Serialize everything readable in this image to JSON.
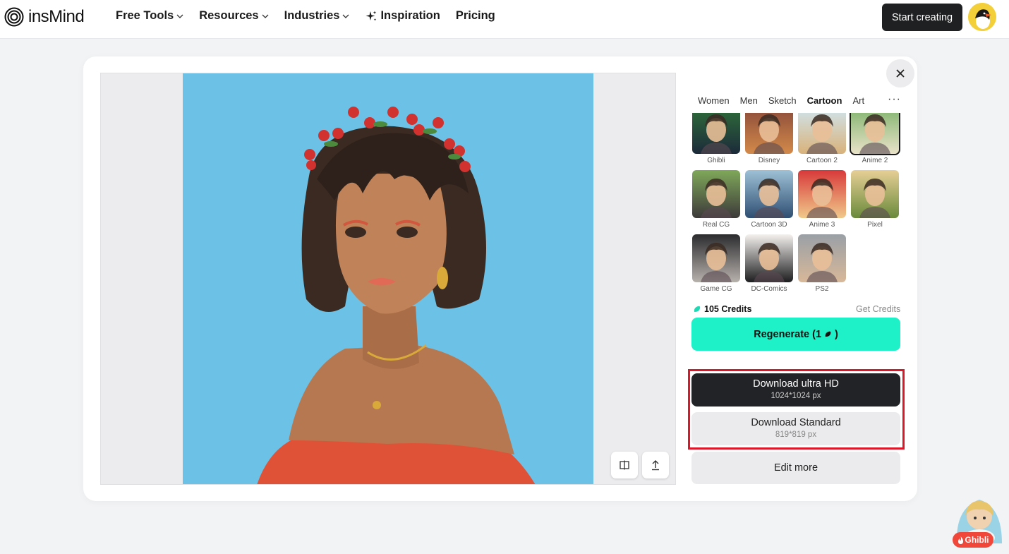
{
  "header": {
    "brand": "insMind",
    "nav": [
      {
        "label": "Free Tools",
        "dropdown": true
      },
      {
        "label": "Resources",
        "dropdown": true
      },
      {
        "label": "Industries",
        "dropdown": true
      },
      {
        "label": "Inspiration",
        "icon": "sparkle-icon"
      },
      {
        "label": "Pricing"
      }
    ],
    "start_button": "Start creating"
  },
  "tabs": {
    "items": [
      "Women",
      "Men",
      "Sketch",
      "Cartoon",
      "Art"
    ],
    "active": "Cartoon",
    "more": "···"
  },
  "styles": [
    {
      "label": "Ghibli",
      "color_top": "#2f6f3a",
      "color_bottom": "#1c2a3a"
    },
    {
      "label": "Disney",
      "color_top": "#8a4a3a",
      "color_bottom": "#d38a4a"
    },
    {
      "label": "Cartoon 2",
      "color_top": "#cfe6f0",
      "color_bottom": "#d9b27a"
    },
    {
      "label": "Anime 2",
      "color_top": "#7fb36c",
      "color_bottom": "#e9e2c8",
      "selected": true
    },
    {
      "label": "Real CG",
      "color_top": "#7fa85a",
      "color_bottom": "#3d3a3a"
    },
    {
      "label": "Cartoon 3D",
      "color_top": "#9fc1d6",
      "color_bottom": "#2f4f73"
    },
    {
      "label": "Anime 3",
      "color_top": "#d8393a",
      "color_bottom": "#f0c98a"
    },
    {
      "label": "Pixel",
      "color_top": "#e7cf96",
      "color_bottom": "#6a8a3a"
    },
    {
      "label": "Game CG",
      "color_top": "#2b2b2e",
      "color_bottom": "#b8b2ad"
    },
    {
      "label": "DC-Comics",
      "color_top": "#f4f1ee",
      "color_bottom": "#1d1d1f"
    },
    {
      "label": "PS2",
      "color_top": "#9aa0a6",
      "color_bottom": "#d8b899"
    }
  ],
  "credits": {
    "label": "105 Credits",
    "get_credits": "Get Credits"
  },
  "regenerate": {
    "label": "Regenerate (1",
    "suffix": ")"
  },
  "download_hd": {
    "title": "Download ultra HD",
    "size": "1024*1024 px"
  },
  "download_standard": {
    "title": "Download Standard",
    "size": "819*819 px"
  },
  "edit_more": "Edit more",
  "ghibli_badge": "Ghibli",
  "colors": {
    "accent": "#1ef0c7",
    "dark_button": "#222326",
    "highlight_box": "#d9182a",
    "portrait_background": "#6cc2e6"
  }
}
